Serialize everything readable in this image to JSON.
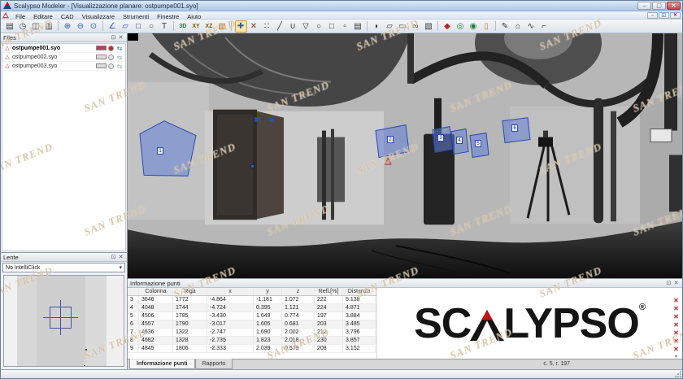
{
  "window": {
    "title": "Scalypso Modeler - [Visualizzazione planare: ostpumpe001.syo]",
    "menu": [
      "File",
      "Editare",
      "CAD",
      "Visualizzare",
      "Strumenti",
      "Finestre",
      "Aiuto"
    ],
    "controls": {
      "min": "–",
      "max": "▢",
      "close": "✕"
    },
    "mdi_controls": {
      "min": "–",
      "restore": "◱",
      "close": "✕"
    }
  },
  "toolbar": {
    "groups": [
      [
        {
          "n": "open-file-button",
          "g": "▤"
        },
        {
          "n": "recent-button",
          "g": "◷"
        },
        {
          "n": "save-button",
          "g": "◫"
        },
        {
          "n": "print-button",
          "g": "▥"
        }
      ],
      [
        {
          "n": "zoom-in-button",
          "g": "⊕",
          "c": "#2a5db0"
        },
        {
          "n": "zoom-out-button",
          "g": "⊖",
          "c": "#2a5db0"
        },
        {
          "n": "zoom-reset-button",
          "g": "⊙",
          "c": "#2a5db0"
        }
      ],
      [
        {
          "n": "angle-measure-button",
          "g": "∠",
          "c": "#2a5db0"
        },
        {
          "n": "polygon-measure-button",
          "g": "▱",
          "c": "#2a5db0"
        },
        {
          "n": "rect-measure-button",
          "g": "□"
        },
        {
          "n": "circle-measure-button",
          "g": "○"
        },
        {
          "n": "text-tool-button",
          "g": "T"
        }
      ],
      [
        {
          "n": "view-3d-button",
          "g": "3D",
          "c": "#1d7a2f",
          "t": 1
        },
        {
          "n": "view-xy-button",
          "g": "XY",
          "c": "#7a5d00",
          "t": 1
        },
        {
          "n": "view-xz-button",
          "g": "XZ",
          "c": "#7a5d00",
          "t": 1
        },
        {
          "n": "view-grid-button",
          "g": "▦",
          "c": "#c87a1e"
        }
      ],
      [
        {
          "n": "pan-tool-button",
          "g": "✚",
          "c": "#2a5db0",
          "sel": 1
        },
        {
          "n": "delete-points-button",
          "g": "✕",
          "c": "#c02020"
        },
        {
          "n": "scatter-select-button",
          "g": "∷"
        },
        {
          "n": "line-tool-button",
          "g": "╱"
        },
        {
          "n": "polyline-tool-button",
          "g": "∪"
        },
        {
          "n": "polygon-tool-button",
          "g": "▽"
        },
        {
          "n": "circle-tool-button",
          "g": "○"
        },
        {
          "n": "rect-tool-button",
          "g": "□"
        },
        {
          "n": "fence-select-button",
          "g": "▫"
        },
        {
          "n": "layers-button",
          "g": "▤"
        }
      ],
      [
        {
          "n": "fit-wedge-button",
          "g": "◗"
        },
        {
          "n": "fit-plane-button",
          "g": "▱"
        },
        {
          "n": "fit-box-button",
          "g": "▭"
        },
        {
          "n": "fit-pipe-button",
          "g": "∞"
        },
        {
          "n": "fit-sheet-button",
          "g": "▧"
        }
      ],
      [
        {
          "n": "target-point-button",
          "g": "◆",
          "c": "#c02020"
        },
        {
          "n": "target-a-button",
          "g": "◎",
          "c": "#1d7a2f"
        },
        {
          "n": "target-b-button",
          "g": "◉",
          "c": "#1d7a2f"
        },
        {
          "n": "leveling-rod-button",
          "g": "▯",
          "c": "#c87a1e"
        }
      ],
      [
        {
          "n": "annotate-button",
          "g": "✎"
        },
        {
          "n": "export-model-button",
          "g": "⌂"
        },
        {
          "n": "pipe-run-button",
          "g": "∿"
        },
        {
          "n": "pipe-fitting-button",
          "g": "⌐"
        }
      ]
    ]
  },
  "files_panel": {
    "title": "Files",
    "items": [
      {
        "name": "ostpumpe001.syo",
        "active": true,
        "swatch": "#c23a5a",
        "dot": "#cc2222"
      },
      {
        "name": "ostpumpe002.syo",
        "active": false,
        "swatch": "#dcdcdc",
        "dot": "#e6e6e6"
      },
      {
        "name": "ostpumpe003.syo",
        "active": false,
        "swatch": "#dcdcdc",
        "dot": "#e6e6e6"
      }
    ]
  },
  "lens_panel": {
    "title": "Lente",
    "dropdown_value": "No IntelliClick"
  },
  "viewport": {
    "markers": [
      "1",
      "2",
      "3",
      "4",
      "5",
      "6"
    ]
  },
  "info_panel": {
    "title": "Informazione punti",
    "columns": [
      "",
      "Colonna",
      "Riga",
      "x",
      "y",
      "z",
      "Refl.[%]",
      "Distanza"
    ],
    "rows": [
      [
        "3",
        "3646",
        "1772",
        "-4.864",
        "-1.181",
        "1.072",
        "222",
        "5.138"
      ],
      [
        "4",
        "4048",
        "1744",
        "-4.724",
        "0.395",
        "1.121",
        "224",
        "4.871"
      ],
      [
        "5",
        "4506",
        "1785",
        "-3.430",
        "1.649",
        "0.774",
        "197",
        "3.884"
      ],
      [
        "6",
        "4557",
        "1790",
        "-3.017",
        "1.605",
        "0.681",
        "203",
        "3.485"
      ],
      [
        "7",
        "4636",
        "1322",
        "-2.747",
        "1.690",
        "2.002",
        "212",
        "3.796"
      ],
      [
        "8",
        "4682",
        "1328",
        "-2.735",
        "1.823",
        "2.018",
        "230",
        "3.857"
      ],
      [
        "9",
        "4845",
        "1806",
        "-2.333",
        "2.039",
        "0.579",
        "208",
        "3.152"
      ]
    ],
    "tabs": [
      "Informazione punti",
      "Rapporto"
    ],
    "status": "c. 5, r. 197",
    "logo": {
      "left": "SC",
      "right": "LYPSO",
      "reg": "®"
    }
  },
  "ui_icons": {
    "pin": "⊡",
    "close": "✕",
    "dropdown": "▾",
    "row_delete": "✕",
    "col_arrow": "▾",
    "scan": "△",
    "move": "⇆"
  },
  "watermark": {
    "text": "SAN TREND"
  },
  "colors": {
    "accent_red": "#cc2222",
    "polygon_blue": "#2b4bb0",
    "active_swatch": "#c23a5a",
    "logo_red": "#cc1111"
  }
}
